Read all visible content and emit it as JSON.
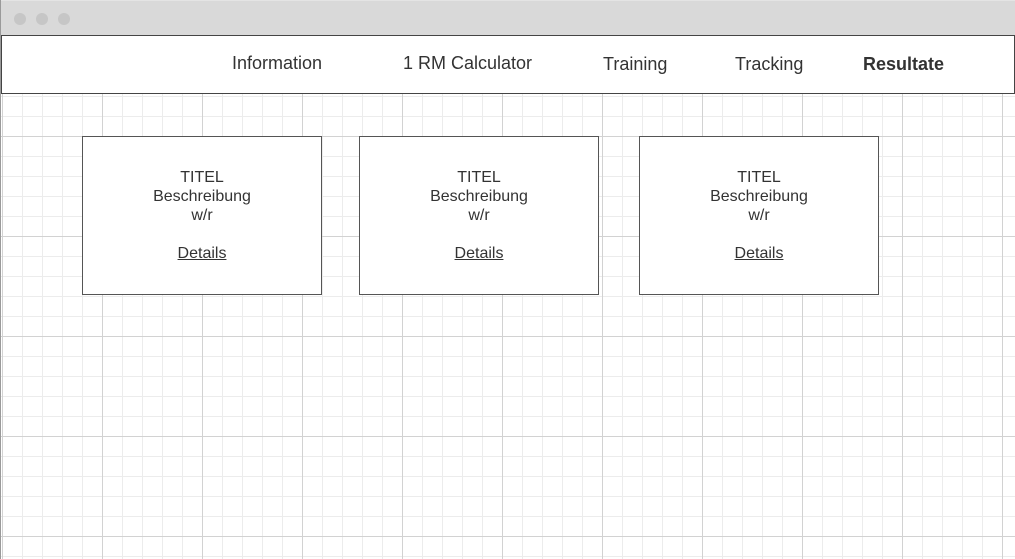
{
  "nav": {
    "items": [
      {
        "label": "Information",
        "active": false
      },
      {
        "label": "1 RM Calculator",
        "active": false
      },
      {
        "label": "Training",
        "active": false
      },
      {
        "label": "Tracking",
        "active": false
      },
      {
        "label": "Resultate",
        "active": true
      }
    ]
  },
  "cards": [
    {
      "title": "TITEL",
      "description": "Beschreibung",
      "meta": "w/r",
      "link": "Details"
    },
    {
      "title": "TITEL",
      "description": "Beschreibung",
      "meta": "w/r",
      "link": "Details"
    },
    {
      "title": "TITEL",
      "description": "Beschreibung",
      "meta": "w/r",
      "link": "Details"
    }
  ]
}
